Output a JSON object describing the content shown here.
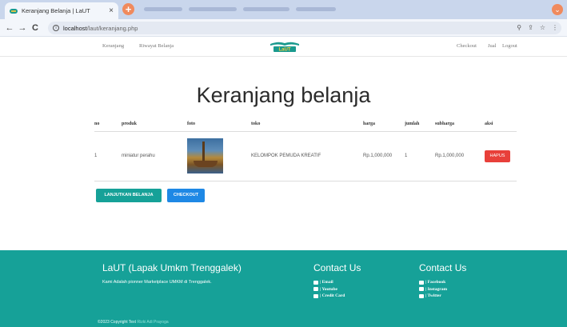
{
  "browser": {
    "tab_title": "Keranjang Belanja | LaUT",
    "tab_close": "×",
    "new_tab": "+",
    "url_host": "localhost",
    "url_path": "/laut/keranjang.php",
    "back": "←",
    "forward": "→",
    "reload": "C",
    "icons": [
      "zoom-icon",
      "share-icon",
      "star-icon",
      "menu-icon"
    ]
  },
  "nav": {
    "keranjang": "Keranjang",
    "riwayat": "Riwayat Belanja",
    "logo": "LaUT",
    "checkout": "Checkout",
    "jual": "Jual",
    "logout": "Logout"
  },
  "page": {
    "title": "Keranjang belanja"
  },
  "cart": {
    "headers": [
      "no",
      "produk",
      "foto",
      "toko",
      "harga",
      "jumlah",
      "subharga",
      "aksi"
    ],
    "rows": [
      {
        "no": "1",
        "produk": "miniatur perahu",
        "toko": "KELOMPOK PEMUDA KREATIF",
        "harga": "Rp.1,000,000",
        "jumlah": "1",
        "subharga": "Rp.1,000,000",
        "aksi": "HAPUS"
      }
    ]
  },
  "actions": {
    "lanjutkan": "LANJUTKAN BELANJA",
    "checkout": "CHECKOUT"
  },
  "footer": {
    "brand": "LaUT (Lapak Umkm Trenggalek)",
    "desc": "Kami Adalah pionner Marketplace UMKM di Trenggalek.",
    "contact1_title": "Contact Us",
    "contact1": [
      "| Email",
      "| Youtube",
      "| Credit Card"
    ],
    "contact2_title": "Contact Us",
    "contact2": [
      "| Facebook",
      "| Instagram",
      "| Twitter"
    ],
    "copy": "©2023 Copyright Text",
    "author": "Rizki Adi Prayoga"
  },
  "colors": {
    "teal": "#16a198",
    "danger": "#e8403a",
    "primary": "#1e88e5"
  }
}
